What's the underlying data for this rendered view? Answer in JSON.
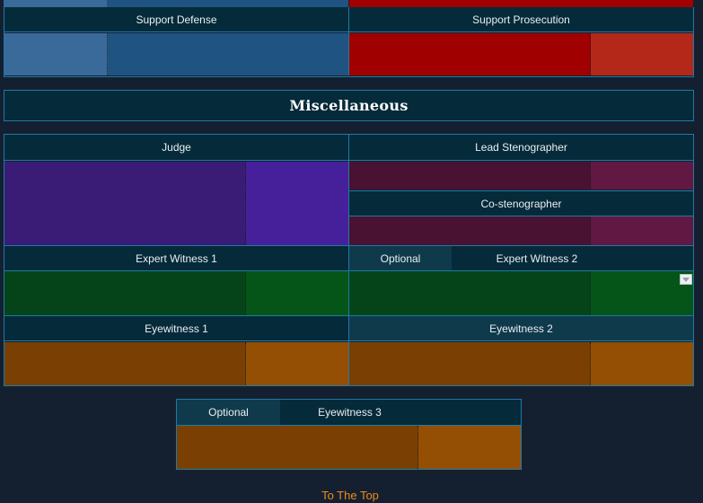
{
  "support": {
    "defense_label": "Support Defense",
    "prosecution_label": "Support Prosecution"
  },
  "misc": {
    "title": "Miscellaneous"
  },
  "roles": {
    "judge": "Judge",
    "lead_stenographer": "Lead Stenographer",
    "co_stenographer": "Co-stenographer",
    "expert_witness_1": "Expert Witness 1",
    "expert_witness_2": "Expert Witness 2",
    "eyewitness_1": "Eyewitness 1",
    "eyewitness_2": "Eyewitness 2",
    "eyewitness_3": "Eyewitness 3",
    "optional_label": "Optional"
  },
  "footer": {
    "to_top": "To The Top"
  },
  "colors": {
    "defense_blue_light": "#3a6a9a",
    "defense_blue": "#1f5482",
    "prosecution_red": "#a00000",
    "prosecution_red_light": "#b4281a",
    "judge_purple": "#3a1c76",
    "judge_purple_light": "#46209a",
    "steno_maroon": "#4a1232",
    "steno_maroon_light": "#611843",
    "expert_green": "#044418",
    "expert_green_light": "#055518",
    "eye_orange": "#7a4003",
    "eye_orange_light": "#944f04",
    "header_bg": "#052a3a",
    "border": "#1d7ba5",
    "link_orange": "#f08a1c"
  }
}
